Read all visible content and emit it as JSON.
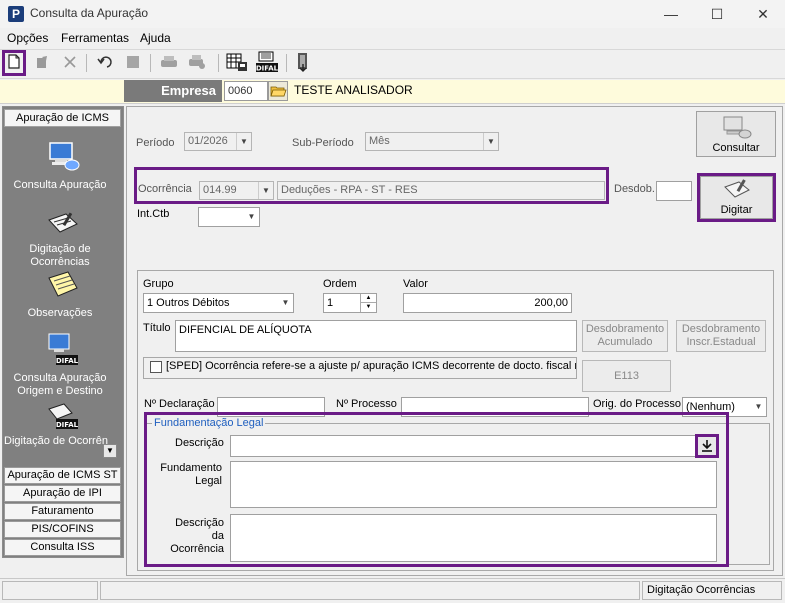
{
  "window": {
    "title": "Consulta da Apuração",
    "logo": "P",
    "minimize": "—",
    "maximize": "☐",
    "close": "✕"
  },
  "menu": [
    "Opções",
    "Ferramentas",
    "Ajuda"
  ],
  "empresa": {
    "label": "Empresa",
    "code": "0060",
    "name": "TESTE ANALISADOR"
  },
  "nav": {
    "header": "Apuração de ICMS",
    "items": [
      "Consulta Apuração",
      "Digitação de Ocorrências",
      "Observações",
      "Consulta Apuração Origem e Destino",
      "Digitação de Ocorrências Orig. De"
    ],
    "bottom": [
      "Apuração de ICMS ST",
      "Apuração de IPI",
      "Faturamento",
      "PIS/COFINS",
      "Consulta ISS"
    ]
  },
  "form": {
    "periodo_label": "Período",
    "periodo_value": "01/2026",
    "subperiodo_label": "Sub-Período",
    "subperiodo_value": "Mês",
    "consultar": "Consultar",
    "ocorrencia_label": "Ocorrência",
    "ocorrencia_code": "014.99",
    "ocorrencia_desc": "Deduções - RPA - ST - RES",
    "desdob_label": "Desdob.",
    "digitar": "Digitar",
    "intctb_label": "Int.Ctb",
    "grupo_label": "Grupo",
    "grupo_value": "1 Outros Débitos",
    "ordem_label": "Ordem",
    "ordem_value": "1",
    "valor_label": "Valor",
    "valor_value": "200,00",
    "titulo_label": "Título",
    "titulo_value": "DIFENCIAL DE ALÍQUOTA",
    "desdob_acum": "Desdobramento Acumulado",
    "desdob_inscr": "Desdobramento Inscr.Estadual",
    "sped_text": "[SPED] Ocorrência refere-se a ajuste p/ apuração ICMS decorrente de docto. fiscal nã",
    "e113": "E113",
    "num_declaracao_label": "Nº Declaração",
    "num_processo_label": "Nº Processo",
    "orig_processo_label": "Orig. do Processo",
    "orig_processo_value": "(Nenhum)",
    "fund_legend": "Fundamentação Legal",
    "descricao_label": "Descrição",
    "fundamento_label": "Fundamento Legal",
    "desc_ocorrencia_label": "Descrição da Ocorrência"
  },
  "status": {
    "right": "Digitação Ocorrências"
  },
  "colors": {
    "highlight": "#6a1b86",
    "nav_bg": "#808080",
    "empresa_bg": "#fefbdc"
  }
}
